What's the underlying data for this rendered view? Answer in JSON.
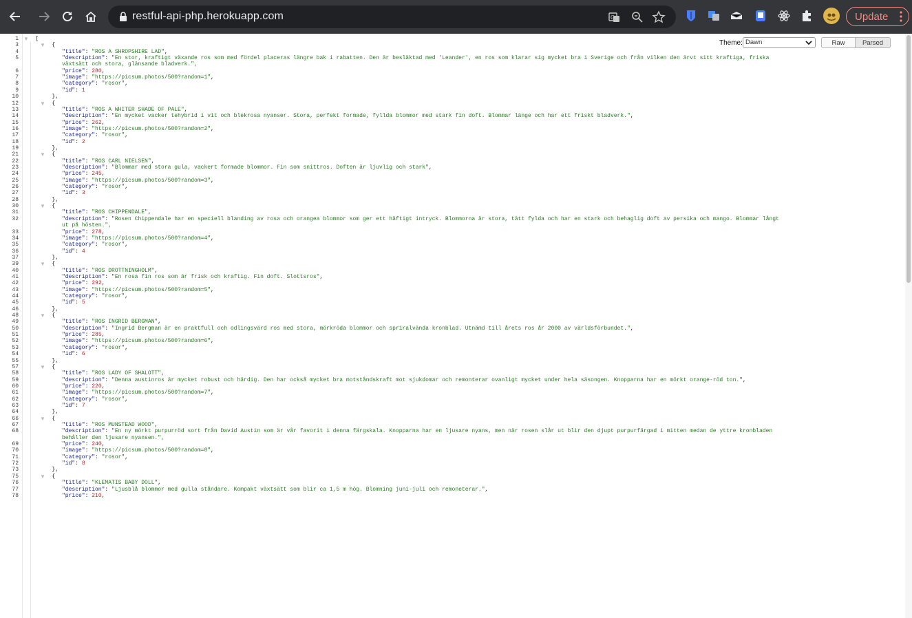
{
  "browser": {
    "url": "restful-api-php.herokuapp.com",
    "update_label": "Update",
    "icons": [
      "back-icon",
      "forward-icon",
      "reload-icon",
      "home-icon",
      "lock-icon",
      "translate-icon",
      "zoom-icon",
      "bookmark-star-icon",
      "bitwarden-extension-icon",
      "translate-extension-icon",
      "extension-icon",
      "extension-icon",
      "react-devtools-icon",
      "puzzle-extensions-icon",
      "profile-avatar-icon",
      "more-vert-icon"
    ]
  },
  "controls": {
    "theme_label": "Theme:",
    "theme_value": "Dawn",
    "raw_label": "Raw",
    "parsed_label": "Parsed"
  },
  "lines": [
    {
      "n": "1",
      "t": "["
    },
    {
      "n": "3",
      "t": "  {"
    },
    {
      "n": "4",
      "k": "title",
      "v": "\"ROS A SHROPSHIRE LAD\"",
      "vt": "s"
    },
    {
      "n": "5",
      "k": "description",
      "v": "\"En stor, kraftigt växande ros som med fördel placeras längre bak i rabatten. Den är besläktad med 'Leander', en ros som klarar sig mycket bra i Sverige och från vilken den ärvt sitt kraftiga, friska",
      "vt": "s",
      "nc": true
    },
    {
      "n": "",
      "c": "växtsätt och stora, glänsande bladverk.\",",
      "vt": "s"
    },
    {
      "n": "6",
      "k": "price",
      "v": "280",
      "vt": "n"
    },
    {
      "n": "7",
      "k": "image",
      "v": "\"https://picsum.photos/500?random=1\"",
      "vt": "s"
    },
    {
      "n": "8",
      "k": "category",
      "v": "\"rosor\"",
      "vt": "s"
    },
    {
      "n": "9",
      "k": "id",
      "v": "1",
      "vt": "n",
      "last": true
    },
    {
      "n": "10",
      "t": "  },"
    },
    {
      "n": "12",
      "t": "  {"
    },
    {
      "n": "13",
      "k": "title",
      "v": "\"ROS A WHITER SHADE OF PALE\"",
      "vt": "s"
    },
    {
      "n": "14",
      "k": "description",
      "v": "\"En mycket vacker tehybrid i vit och blekrosa nyanser. Stora, perfekt formade, fyllda blommor med stark fin doft. Blommar länge och har ett friskt bladverk.\"",
      "vt": "s"
    },
    {
      "n": "15",
      "k": "price",
      "v": "262",
      "vt": "n"
    },
    {
      "n": "16",
      "k": "image",
      "v": "\"https://picsum.photos/500?random=2\"",
      "vt": "s"
    },
    {
      "n": "17",
      "k": "category",
      "v": "\"rosor\"",
      "vt": "s"
    },
    {
      "n": "18",
      "k": "id",
      "v": "2",
      "vt": "n",
      "last": true
    },
    {
      "n": "19",
      "t": "  },"
    },
    {
      "n": "21",
      "t": "  {"
    },
    {
      "n": "22",
      "k": "title",
      "v": "\"ROS CARL NIELSEN\"",
      "vt": "s"
    },
    {
      "n": "23",
      "k": "description",
      "v": "\"Blommar med stora gula, vackert formade blommor. Fin som snittros. Doften är ljuvlig och stark\"",
      "vt": "s"
    },
    {
      "n": "24",
      "k": "price",
      "v": "245",
      "vt": "n"
    },
    {
      "n": "25",
      "k": "image",
      "v": "\"https://picsum.photos/500?random=3\"",
      "vt": "s"
    },
    {
      "n": "26",
      "k": "category",
      "v": "\"rosor\"",
      "vt": "s"
    },
    {
      "n": "27",
      "k": "id",
      "v": "3",
      "vt": "n",
      "last": true
    },
    {
      "n": "28",
      "t": "  },"
    },
    {
      "n": "30",
      "t": "  {"
    },
    {
      "n": "31",
      "k": "title",
      "v": "\"ROS CHIPPENDALE\"",
      "vt": "s"
    },
    {
      "n": "32",
      "k": "description",
      "v": "\"Rosen Chippendale har en speciell blanding av rosa och orangea blommor som ger ett häftigt intryck. Blommorna är stora, tätt fylda och har en stark och behaglig doft av persika och mango. Blommar långt",
      "vt": "s",
      "nc": true
    },
    {
      "n": "",
      "c": "ut på hösten.\",",
      "vt": "s"
    },
    {
      "n": "33",
      "k": "price",
      "v": "278",
      "vt": "n"
    },
    {
      "n": "34",
      "k": "image",
      "v": "\"https://picsum.photos/500?random=4\"",
      "vt": "s"
    },
    {
      "n": "35",
      "k": "category",
      "v": "\"rosor\"",
      "vt": "s"
    },
    {
      "n": "36",
      "k": "id",
      "v": "4",
      "vt": "n",
      "last": true
    },
    {
      "n": "37",
      "t": "  },"
    },
    {
      "n": "39",
      "t": "  {"
    },
    {
      "n": "40",
      "k": "title",
      "v": "\"ROS DROTTNINGHOLM\"",
      "vt": "s"
    },
    {
      "n": "41",
      "k": "description",
      "v": "\"En rosa fin ros som är frisk och kraftig. Fin doft. Slottsros\"",
      "vt": "s"
    },
    {
      "n": "42",
      "k": "price",
      "v": "292",
      "vt": "n"
    },
    {
      "n": "43",
      "k": "image",
      "v": "\"https://picsum.photos/500?random=5\"",
      "vt": "s"
    },
    {
      "n": "44",
      "k": "category",
      "v": "\"rosor\"",
      "vt": "s"
    },
    {
      "n": "45",
      "k": "id",
      "v": "5",
      "vt": "n",
      "last": true
    },
    {
      "n": "46",
      "t": "  },"
    },
    {
      "n": "48",
      "t": "  {"
    },
    {
      "n": "49",
      "k": "title",
      "v": "\"ROS INGRID BERGMAN\"",
      "vt": "s"
    },
    {
      "n": "50",
      "k": "description",
      "v": "\"Ingrid Bergman är en praktfull och odlingsvärd ros med stora, mörkröda blommor och spriralvända kronblad. Utnämd till årets ros år 2000 av världsförbundet.\"",
      "vt": "s"
    },
    {
      "n": "51",
      "k": "price",
      "v": "285",
      "vt": "n"
    },
    {
      "n": "52",
      "k": "image",
      "v": "\"https://picsum.photos/500?random=6\"",
      "vt": "s"
    },
    {
      "n": "53",
      "k": "category",
      "v": "\"rosor\"",
      "vt": "s"
    },
    {
      "n": "54",
      "k": "id",
      "v": "6",
      "vt": "n",
      "last": true
    },
    {
      "n": "55",
      "t": "  },"
    },
    {
      "n": "57",
      "t": "  {"
    },
    {
      "n": "58",
      "k": "title",
      "v": "\"ROS LADY OF SHALOTT\"",
      "vt": "s"
    },
    {
      "n": "59",
      "k": "description",
      "v": "\"Denna austinros är mycket robust och härdig. Den har också mycket bra motståndskraft mot sjukdomar och remonterar ovanligt mycket under hela säsongen. Knopparna har en mörkt orange-röd ton.\"",
      "vt": "s"
    },
    {
      "n": "60",
      "k": "price",
      "v": "220",
      "vt": "n"
    },
    {
      "n": "61",
      "k": "image",
      "v": "\"https://picsum.photos/500?random=7\"",
      "vt": "s"
    },
    {
      "n": "62",
      "k": "category",
      "v": "\"rosor\"",
      "vt": "s"
    },
    {
      "n": "63",
      "k": "id",
      "v": "7",
      "vt": "n",
      "last": true
    },
    {
      "n": "64",
      "t": "  },"
    },
    {
      "n": "66",
      "t": "  {"
    },
    {
      "n": "67",
      "k": "title",
      "v": "\"ROS MUNSTEAD WOOD\"",
      "vt": "s"
    },
    {
      "n": "68",
      "k": "description",
      "v": "\"En ny mörkt purpurröd sort från David Austin som är vår favorit i denna färgskala. Knopparna har en ljusare nyans, men när rosen slår ut blir den djupt purpurfärgad i mitten medan de yttre kronbladen",
      "vt": "s",
      "nc": true
    },
    {
      "n": "",
      "c": "behåller den ljusare nyansen.\",",
      "vt": "s"
    },
    {
      "n": "69",
      "k": "price",
      "v": "240",
      "vt": "n"
    },
    {
      "n": "70",
      "k": "image",
      "v": "\"https://picsum.photos/500?random=8\"",
      "vt": "s"
    },
    {
      "n": "71",
      "k": "category",
      "v": "\"rosor\"",
      "vt": "s"
    },
    {
      "n": "72",
      "k": "id",
      "v": "8",
      "vt": "n",
      "last": true
    },
    {
      "n": "73",
      "t": "  },"
    },
    {
      "n": "75",
      "t": "  {"
    },
    {
      "n": "76",
      "k": "title",
      "v": "\"KLEMATIS BABY DOLL\"",
      "vt": "s"
    },
    {
      "n": "77",
      "k": "description",
      "v": "\"Ljusblå blommor med gulla ståndare. Kompakt växtsätt som blir ca 1,5 m hög. Blomning juni-juli och remoneterar.\"",
      "vt": "s"
    },
    {
      "n": "78",
      "k": "price",
      "v": "210",
      "vt": "n"
    }
  ]
}
